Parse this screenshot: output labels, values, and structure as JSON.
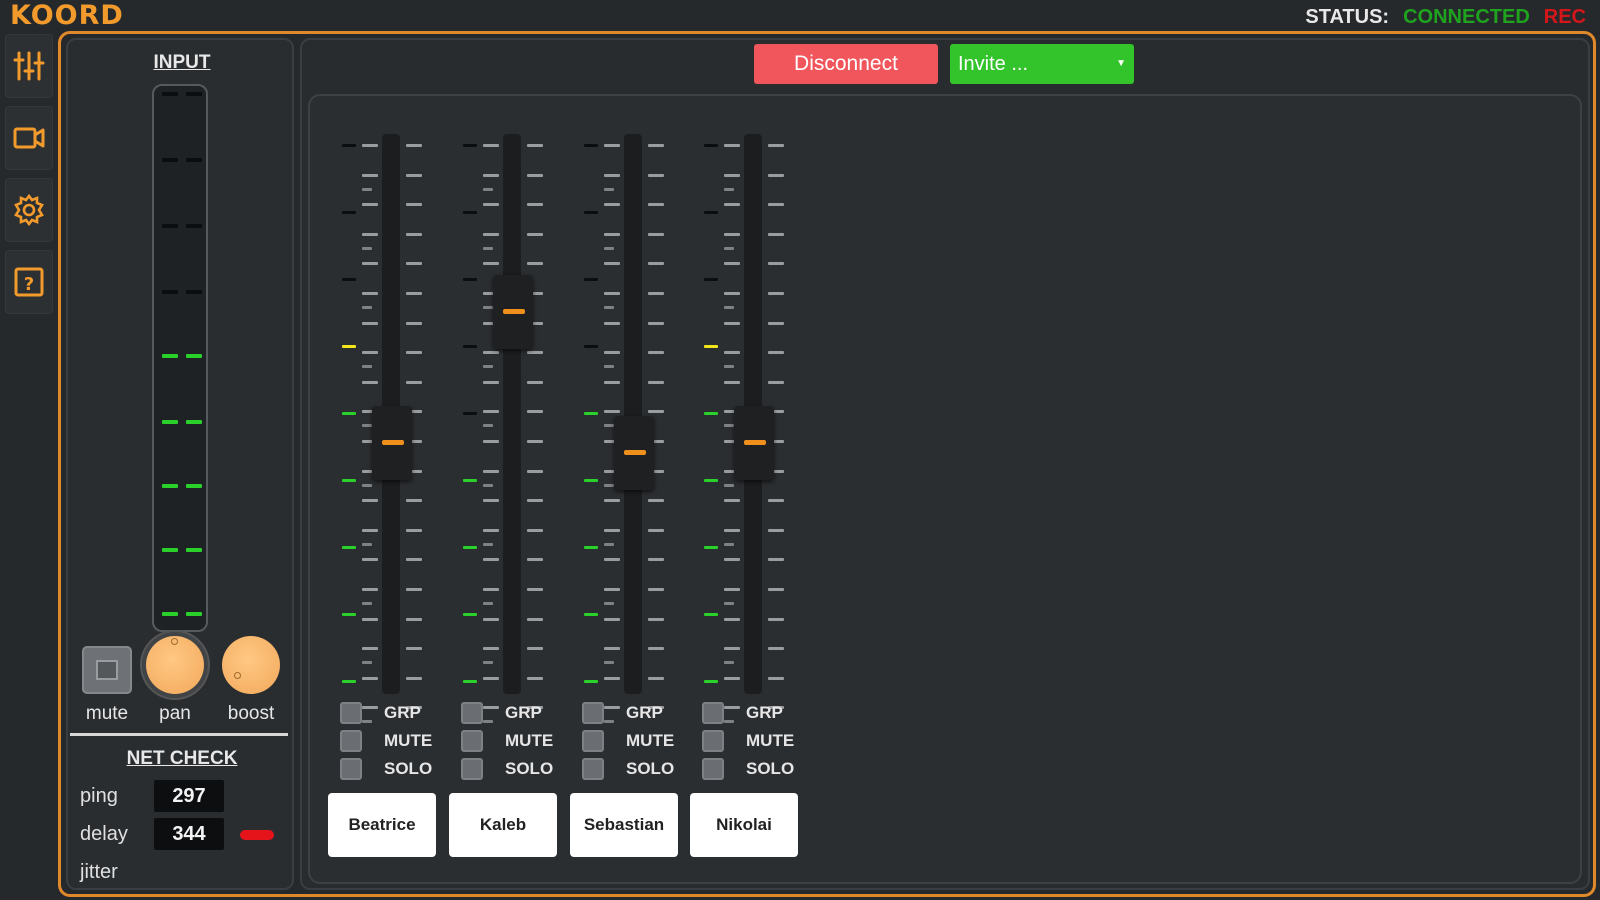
{
  "app": {
    "logo": "KOORD"
  },
  "status": {
    "label": "STATUS:",
    "connection": "CONNECTED",
    "rec": "REC"
  },
  "toolbar": [
    {
      "name": "mixer-sliders-icon"
    },
    {
      "name": "video-camera-icon"
    },
    {
      "name": "gear-icon"
    },
    {
      "name": "help-icon"
    }
  ],
  "input": {
    "title": "INPUT",
    "mute_label": "mute",
    "pan_label": "pan",
    "boost_label": "boost"
  },
  "net_check": {
    "title": "NET CHECK",
    "ping_label": "ping",
    "ping_value": "297",
    "delay_label": "delay",
    "delay_value": "344",
    "jitter_label": "jitter"
  },
  "controls": {
    "disconnect_label": "Disconnect",
    "invite_label": "Invite ..."
  },
  "channels": [
    {
      "name": "Beatrice",
      "fader_level": 0.44,
      "meter_level": "yellow",
      "grp": "GRP",
      "mute": "MUTE",
      "solo": "SOLO"
    },
    {
      "name": "Kaleb",
      "fader_level": 0.71,
      "meter_level": "none",
      "grp": "GRP",
      "mute": "MUTE",
      "solo": "SOLO"
    },
    {
      "name": "Sebastian",
      "fader_level": 0.42,
      "meter_level": "green",
      "grp": "GRP",
      "mute": "MUTE",
      "solo": "SOLO"
    },
    {
      "name": "Nikolai",
      "fader_level": 0.44,
      "meter_level": "yellow",
      "grp": "GRP",
      "mute": "MUTE",
      "solo": "SOLO"
    }
  ],
  "colors": {
    "accent": "#f29a2c",
    "connected": "#1fa31f",
    "rec": "#d4161a",
    "disconnect": "#f0565c",
    "invite": "#33c42b",
    "meter_green": "#2ad12a",
    "meter_yellow": "#f2e51a"
  }
}
